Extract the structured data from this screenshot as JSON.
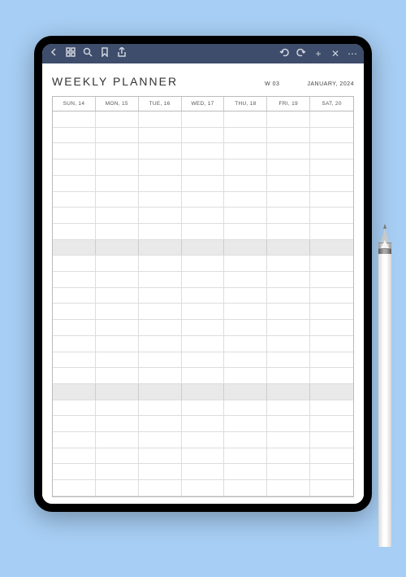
{
  "toolbar": {
    "icons_left": [
      "back",
      "grid",
      "search",
      "bookmark",
      "share"
    ],
    "icons_right": [
      "undo",
      "redo",
      "add",
      "close",
      "more"
    ]
  },
  "planner": {
    "title": "WEEKLY PLANNER",
    "week": "W 03",
    "month": "JANUARY, 2024",
    "days": [
      "SUN, 14",
      "MON, 15",
      "TUE, 16",
      "WED, 17",
      "THU, 18",
      "FRI, 19",
      "SAT, 20"
    ],
    "rows": 24,
    "shaded_rows": [
      8,
      17
    ]
  }
}
